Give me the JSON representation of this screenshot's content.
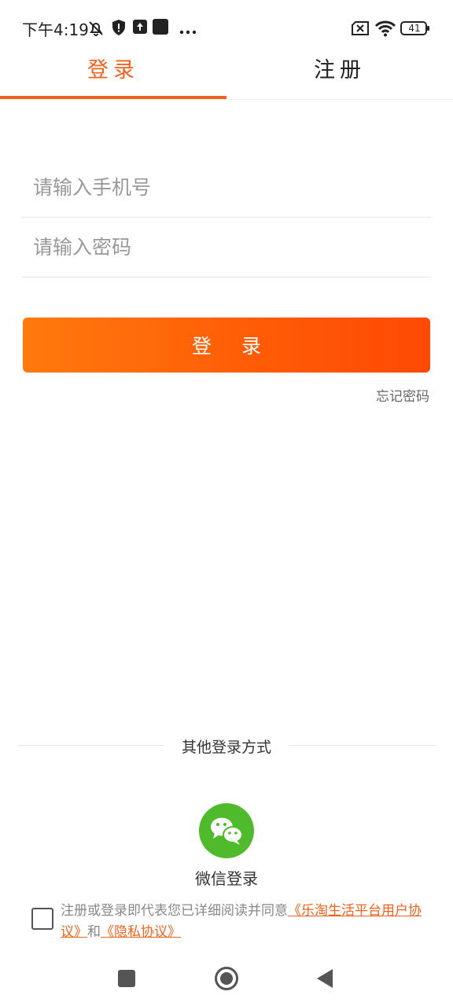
{
  "status_bar": {
    "time": "下午4:19",
    "icons": [
      "muted-bell-icon",
      "shield-icon",
      "upload-icon",
      "square-app-icon",
      "more-dots-icon",
      "sim-x-icon",
      "wifi-icon",
      "battery-icon"
    ],
    "battery": "41"
  },
  "tabs": [
    {
      "label": "登录"
    },
    {
      "label": "注册"
    }
  ],
  "form": {
    "phone_placeholder": "请输入手机号",
    "password_placeholder": "请输入密码",
    "login_label": "登录",
    "forgot_label": "忘记密码"
  },
  "other_login": {
    "title": "其他登录方式",
    "wechat_label": "微信登录"
  },
  "agreement": {
    "prefix": "注册或登录即代表您已详细阅读并同意",
    "user_agreement": "《乐淘生活平台用户协议》",
    "and": "和",
    "privacy": "《隐私协议》"
  },
  "colors": {
    "accent": "#f0621d",
    "button_gradient_start": "#ff7a0d",
    "button_gradient_end": "#ff4a05",
    "wechat_green": "#4fba2b"
  }
}
